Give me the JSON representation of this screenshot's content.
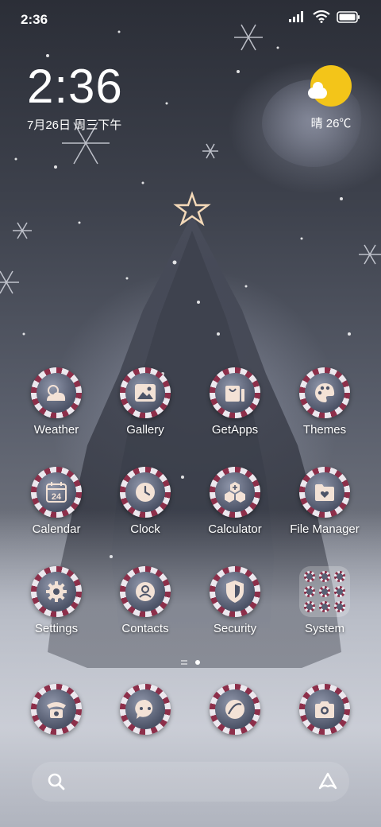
{
  "status_bar": {
    "time": "2:36",
    "icons": [
      "signal-icon",
      "wifi-icon",
      "battery-icon"
    ]
  },
  "clock_widget": {
    "time": "2:36",
    "date": "7月26日 周三下午"
  },
  "weather_widget": {
    "icon": "sun-cloud-icon",
    "text": "晴 26℃"
  },
  "apps": [
    {
      "label": "Weather",
      "icon": "weather-icon"
    },
    {
      "label": "Gallery",
      "icon": "gallery-icon"
    },
    {
      "label": "GetApps",
      "icon": "getapps-icon"
    },
    {
      "label": "Themes",
      "icon": "palette-icon"
    },
    {
      "label": "Calendar",
      "icon": "calendar-icon",
      "day": "24"
    },
    {
      "label": "Clock",
      "icon": "clock-icon"
    },
    {
      "label": "Calculator",
      "icon": "calculator-icon"
    },
    {
      "label": "File Manager",
      "icon": "folder-heart-icon"
    },
    {
      "label": "Settings",
      "icon": "gear-icon"
    },
    {
      "label": "Contacts",
      "icon": "contact-icon"
    },
    {
      "label": "Security",
      "icon": "shield-icon"
    },
    {
      "label": "System",
      "icon": "folder-icon"
    }
  ],
  "dock": [
    {
      "icon": "phone-icon"
    },
    {
      "icon": "messages-icon"
    },
    {
      "icon": "browser-icon"
    },
    {
      "icon": "camera-icon"
    }
  ],
  "page_indicator": {
    "pages": 2,
    "active": 2
  },
  "search_bar": {
    "left_icon": "search-icon",
    "right_icon": "assistant-icon"
  },
  "colors": {
    "ring_red": "#8d2f4a",
    "ring_white": "#ece8ee",
    "icon_bg": "#4d5468",
    "sun": "#f3c519"
  }
}
